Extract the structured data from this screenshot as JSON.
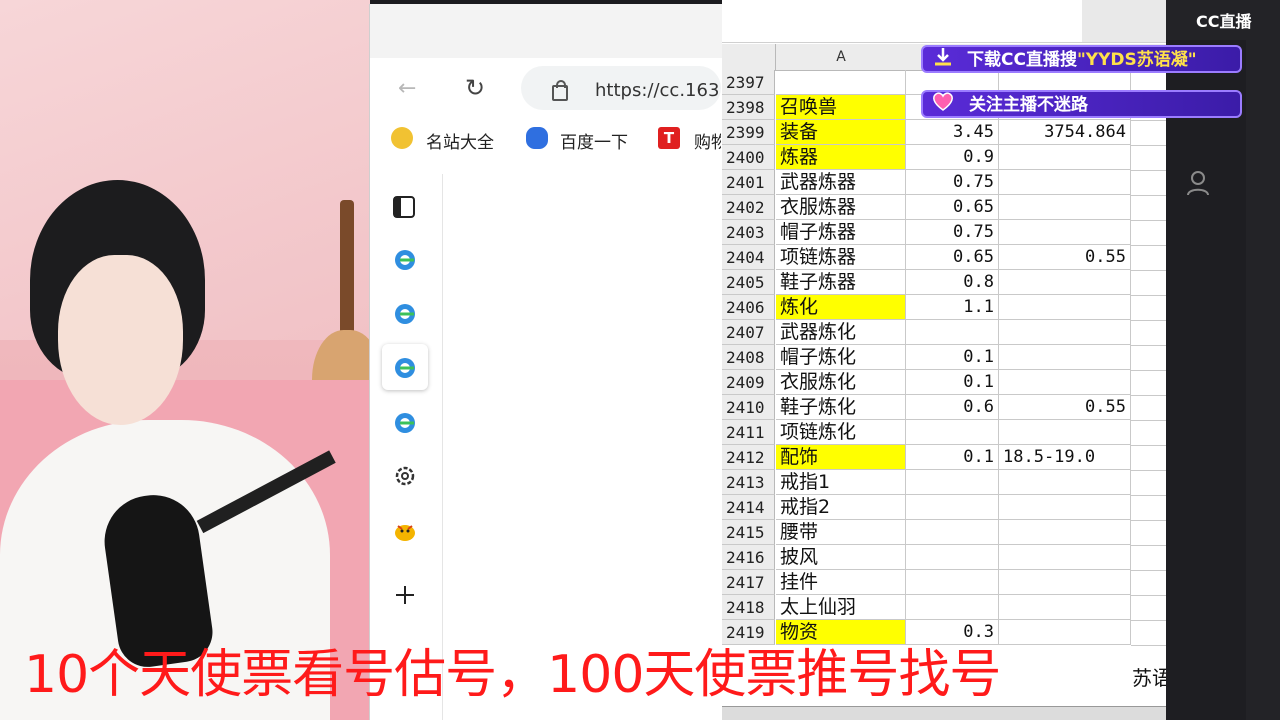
{
  "logo": {
    "text": "CC直播"
  },
  "banners": {
    "download_prefix": "下载CC直播搜",
    "download_highlight": "\"YYDS苏语凝\"",
    "follow": "关注主播不迷路"
  },
  "browser": {
    "url": "https://cc.163",
    "bookmarks": [
      {
        "label": "名站大全",
        "icon": "sites-icon"
      },
      {
        "label": "百度一下",
        "icon": "baidu-icon"
      },
      {
        "label": "购物",
        "icon": "shopping-icon"
      }
    ],
    "sidebar_icons": [
      "collections-icon",
      "edge-icon",
      "edge-icon",
      "edge-icon",
      "edge-icon",
      "settings-icon",
      "mascot-icon",
      "add-icon"
    ]
  },
  "sheet": {
    "column_header": "A",
    "rows": [
      {
        "n": "2397",
        "a": "",
        "b": "",
        "c": "",
        "hl": false
      },
      {
        "n": "2398",
        "a": "召唤兽",
        "b": "",
        "c": "",
        "hl": true
      },
      {
        "n": "2399",
        "a": "装备",
        "b": "3.45",
        "c": "3754.864",
        "hl": true
      },
      {
        "n": "2400",
        "a": "炼器",
        "b": "0.9",
        "c": "",
        "hl": true
      },
      {
        "n": "2401",
        "a": "武器炼器",
        "b": "0.75",
        "c": "",
        "hl": false
      },
      {
        "n": "2402",
        "a": "衣服炼器",
        "b": "0.65",
        "c": "",
        "hl": false
      },
      {
        "n": "2403",
        "a": "帽子炼器",
        "b": "0.75",
        "c": "",
        "hl": false
      },
      {
        "n": "2404",
        "a": "项链炼器",
        "b": "0.65",
        "c": "0.55",
        "hl": false
      },
      {
        "n": "2405",
        "a": "鞋子炼器",
        "b": "0.8",
        "c": "",
        "hl": false
      },
      {
        "n": "2406",
        "a": "炼化",
        "b": "1.1",
        "c": "",
        "hl": true
      },
      {
        "n": "2407",
        "a": "武器炼化",
        "b": "",
        "c": "",
        "hl": false
      },
      {
        "n": "2408",
        "a": "帽子炼化",
        "b": "0.1",
        "c": "",
        "hl": false
      },
      {
        "n": "2409",
        "a": "衣服炼化",
        "b": "0.1",
        "c": "",
        "hl": false
      },
      {
        "n": "2410",
        "a": "鞋子炼化",
        "b": "0.6",
        "c": "0.55",
        "hl": false
      },
      {
        "n": "2411",
        "a": "项链炼化",
        "b": "",
        "c": "",
        "hl": false
      },
      {
        "n": "2412",
        "a": "配饰",
        "b": "0.1",
        "c": "18.5-19.0",
        "hl": true
      },
      {
        "n": "2413",
        "a": "戒指1",
        "b": "",
        "c": "",
        "hl": false
      },
      {
        "n": "2414",
        "a": "戒指2",
        "b": "",
        "c": "",
        "hl": false
      },
      {
        "n": "2415",
        "a": "腰带",
        "b": "",
        "c": "",
        "hl": false
      },
      {
        "n": "2416",
        "a": "披风",
        "b": "",
        "c": "",
        "hl": false
      },
      {
        "n": "2417",
        "a": "挂件",
        "b": "",
        "c": "",
        "hl": false
      },
      {
        "n": "2418",
        "a": "太上仙羽",
        "b": "",
        "c": "",
        "hl": false
      },
      {
        "n": "2419",
        "a": "物资",
        "b": "0.3",
        "c": "",
        "hl": true
      }
    ],
    "side_text": "苏语"
  },
  "subtitle": "10个天使票看号估号，100天使票推号找号",
  "colors": {
    "highlight": "#ffff00",
    "subtitle": "#ff1a1a",
    "banner": "#5a2bd8"
  }
}
